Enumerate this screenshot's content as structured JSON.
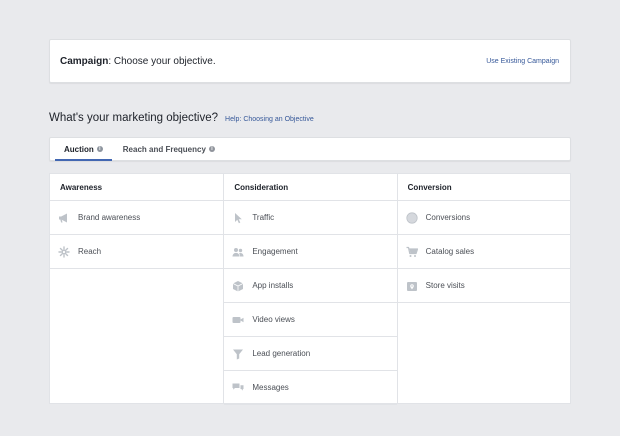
{
  "campaign": {
    "label": "Campaign",
    "prompt": ": Choose your objective.",
    "use_existing": "Use Existing Campaign"
  },
  "objective": {
    "title": "What's your marketing objective?",
    "help": "Help: Choosing an Objective"
  },
  "tabs": [
    {
      "label": "Auction",
      "info": "i",
      "active": true
    },
    {
      "label": "Reach and Frequency",
      "info": "i",
      "active": false
    }
  ],
  "columns": [
    {
      "heading": "Awareness",
      "items": [
        {
          "label": "Brand awareness",
          "icon": "megaphone-icon"
        },
        {
          "label": "Reach",
          "icon": "asterisk-icon"
        }
      ]
    },
    {
      "heading": "Consideration",
      "items": [
        {
          "label": "Traffic",
          "icon": "cursor-icon"
        },
        {
          "label": "Engagement",
          "icon": "people-icon"
        },
        {
          "label": "App installs",
          "icon": "box-icon"
        },
        {
          "label": "Video views",
          "icon": "video-camera-icon"
        },
        {
          "label": "Lead generation",
          "icon": "funnel-icon"
        },
        {
          "label": "Messages",
          "icon": "chat-bubbles-icon"
        }
      ]
    },
    {
      "heading": "Conversion",
      "items": [
        {
          "label": "Conversions",
          "icon": "globe-icon"
        },
        {
          "label": "Catalog sales",
          "icon": "shopping-cart-icon"
        },
        {
          "label": "Store visits",
          "icon": "store-icon"
        }
      ]
    }
  ],
  "colors": {
    "accent": "#4267b2",
    "link": "#365899",
    "icon": "#bec3c9"
  }
}
